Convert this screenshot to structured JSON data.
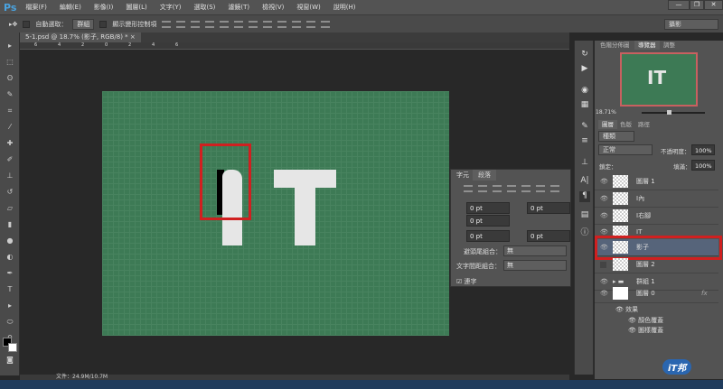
{
  "app": {
    "logo": "Ps",
    "menus": [
      "檔案(F)",
      "編輯(E)",
      "影像(I)",
      "圖層(L)",
      "文字(Y)",
      "選取(S)",
      "濾鏡(T)",
      "檢視(V)",
      "視窗(W)",
      "說明(H)"
    ],
    "window_buttons": [
      "—",
      "❐",
      "✕"
    ]
  },
  "options": {
    "auto_select_label": "自動選取：",
    "auto_select_value": "群組",
    "show_transform_label": "顯示變形控制項",
    "workspace": "攝影"
  },
  "document": {
    "tab_title": "5-1.psd @ 18.7% (影子, RGB/8) *",
    "close": "×",
    "ruler_ticks": [
      "6",
      "4",
      "2",
      "0",
      "2",
      "4",
      "6"
    ],
    "canvas_text": [
      "I",
      "T"
    ]
  },
  "paragraph_panel": {
    "tabs": [
      "字元",
      "段落"
    ],
    "active_tab": "段落",
    "fields": [
      "0 pt",
      "0 pt",
      "0 pt",
      "0 pt",
      "0 pt"
    ],
    "kinsoku_label": "避頭尾組合：",
    "kinsoku_value": "無",
    "mojikumi_label": "文字間距組合：",
    "mojikumi_value": "無",
    "hyphenate_label": "連字",
    "hyphenate_checked": true
  },
  "navigator": {
    "tabs": [
      "色階分佈圖",
      "導覽器",
      "調整"
    ],
    "active_tab": "導覽器",
    "zoom": "18.71%",
    "thumb_text": "IT"
  },
  "layers_panel": {
    "tabs": [
      "圖層",
      "色版",
      "路徑"
    ],
    "active_tab": "圖層",
    "filter": "種類",
    "blend_mode": "正常",
    "opacity_label": "不透明度：",
    "opacity": "100%",
    "lock_label": "鎖定：",
    "fill_label": "填滿：",
    "fill": "100%",
    "layers": [
      {
        "name": "圖層 1",
        "visible": true
      },
      {
        "name": "I內",
        "visible": true
      },
      {
        "name": "I右腳",
        "visible": true
      },
      {
        "name": "IT",
        "visible": true
      },
      {
        "name": "影子",
        "visible": true,
        "selected": true
      },
      {
        "name": "圖層 2",
        "visible": false
      },
      {
        "name": "群組 1",
        "visible": true,
        "group": true
      },
      {
        "name": "圖層 0",
        "visible": true,
        "fx": "fx"
      }
    ],
    "effects_label": "效果",
    "effects": [
      "顏色覆蓋",
      "圖樣覆蓋"
    ]
  },
  "status": {
    "file_info": "文件：24.9M/10.7M"
  },
  "watermark": "iT邦幫忙",
  "colors": {
    "canvas": "#3d7a55",
    "highlight": "#d02020",
    "selected_layer": "#56647a"
  }
}
